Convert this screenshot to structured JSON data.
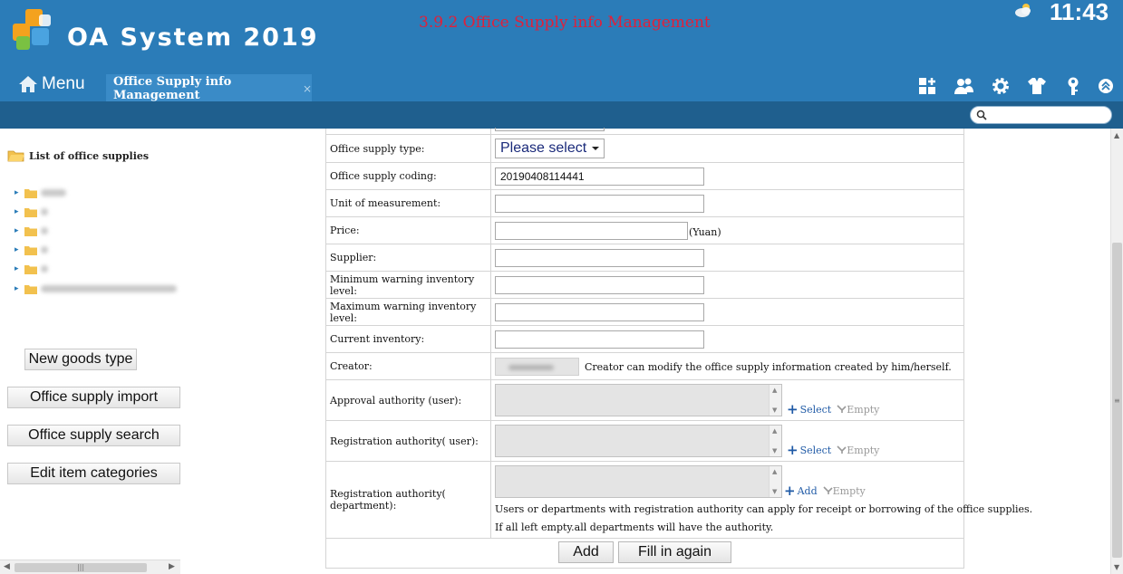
{
  "app": {
    "title": "OA System 2019",
    "caption": "3.9.2 Office Supply info Management",
    "clock": "11:43",
    "menu_label": "Menu",
    "active_tab": "Office Supply info Management",
    "tab_close": "×",
    "colors": {
      "header": "#2b7cb8",
      "subbar": "#1f5f8e",
      "caption": "#e0203a"
    }
  },
  "header_icons": [
    "add-widget-icon",
    "people-icon",
    "gear-icon",
    "shirt-icon",
    "key-icon",
    "chevron-up-circle-icon"
  ],
  "search": {
    "placeholder": ""
  },
  "tree": {
    "title": "List of office supplies",
    "item_count": 6
  },
  "sidebar_buttons": {
    "new_goods_type": "New goods type",
    "import": "Office supply import",
    "search": "Office supply search",
    "edit_categories": "Edit item categories"
  },
  "form": {
    "type_label": "Office supply type:",
    "type_value": "Please select",
    "coding_label": "Office supply coding:",
    "coding_value": "20190408114441",
    "unit_label": "Unit of measurement:",
    "unit_value": "",
    "price_label": "Price:",
    "price_value": "",
    "price_unit": "(Yuan)",
    "supplier_label": "Supplier:",
    "supplier_value": "",
    "min_label": "Minimum warning inventory level:",
    "min_value": "",
    "max_label": "Maximum warning inventory level:",
    "max_value": "",
    "current_label": "Current inventory:",
    "current_value": "",
    "creator_label": "Creator:",
    "creator_note": "Creator can modify the office supply information created by him/herself.",
    "approval_label": "Approval authority (user):",
    "reg_user_label": "Registration authority( user):",
    "reg_dept_label": "Registration authority( department):",
    "select_label": "Select",
    "empty_label": "Empty",
    "add_label": "Add",
    "reg_note_1": "Users or departments with registration authority can apply for receipt or borrowing of the office supplies.",
    "reg_note_2": "If all left empty.all departments will have the authority.",
    "submit_label": "Add",
    "reset_label": "Fill in again"
  }
}
